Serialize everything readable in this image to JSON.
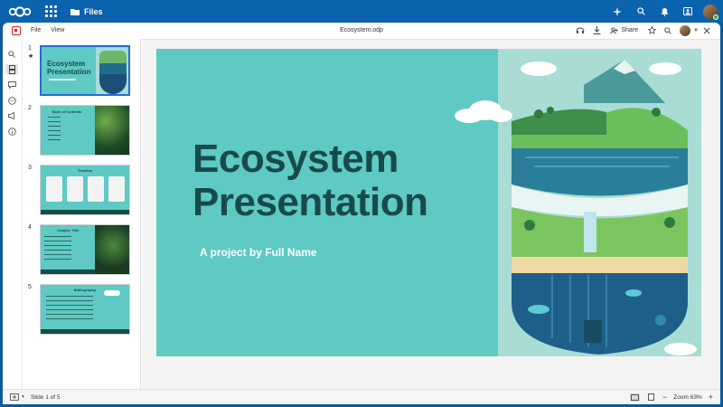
{
  "topbar": {
    "app_name": "Files"
  },
  "menubar": {
    "file_label": "File",
    "view_label": "View",
    "document_title": "Ecosystem.odp",
    "share_label": "Share"
  },
  "slides": {
    "thumbs": [
      {
        "num": "1",
        "title_line1": "Ecosystem",
        "title_line2": "Presentation"
      },
      {
        "num": "2",
        "title": "Table of Contents"
      },
      {
        "num": "3",
        "title": "Timeline"
      },
      {
        "num": "4",
        "title": "Chapter Title"
      },
      {
        "num": "5",
        "title": "Bibliography"
      }
    ]
  },
  "slide": {
    "title_line1": "Ecosystem",
    "title_line2": "Presentation",
    "subtitle": "A project by Full Name"
  },
  "status": {
    "slide_indicator": "Slide 1 of 5",
    "zoom_label": "Zoom 63%"
  },
  "colors": {
    "topbar": "#0b62ad",
    "slide_bg": "#5fc9c3",
    "title_text": "#174b4a",
    "accent_red": "#d62020"
  }
}
